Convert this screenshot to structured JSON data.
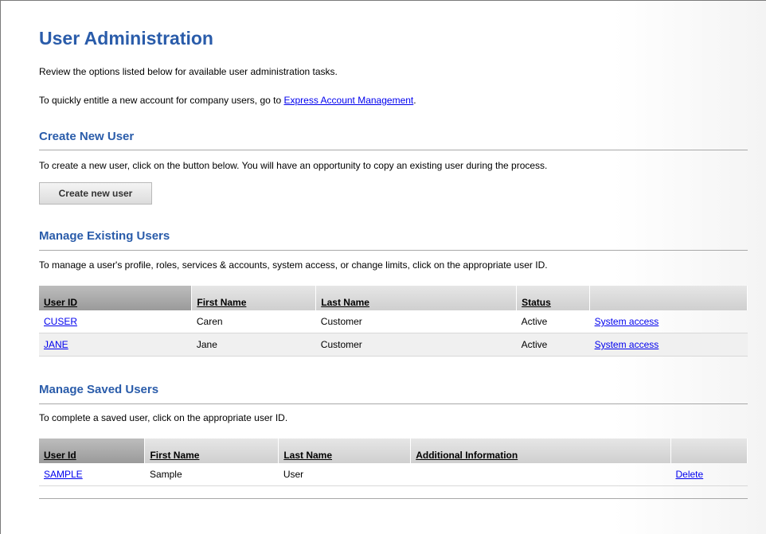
{
  "page": {
    "title": "User Administration",
    "intro": "Review the options listed below for available user administration tasks.",
    "express_prefix": "To quickly entitle a new account for company users, go to ",
    "express_link": "Express Account Management",
    "express_suffix": "."
  },
  "create": {
    "heading": "Create New User",
    "description": "To create a new user, click on the button below. You will have an opportunity to copy an existing user during the process.",
    "button_label": "Create new user"
  },
  "existing": {
    "heading": "Manage Existing Users",
    "description": "To manage a user's profile, roles, services & accounts, system access, or change limits, click on the appropriate user ID.",
    "columns": [
      "User ID",
      "First Name",
      "Last Name",
      "Status"
    ],
    "rows": [
      {
        "user_id": "CUSER",
        "first_name": "Caren",
        "last_name": "Customer",
        "status": "Active",
        "action": "System access"
      },
      {
        "user_id": "JANE",
        "first_name": "Jane",
        "last_name": "Customer",
        "status": "Active",
        "action": "System access"
      }
    ]
  },
  "saved": {
    "heading": "Manage Saved Users",
    "description": "To complete a saved user, click on the appropriate user ID.",
    "columns": [
      "User Id",
      "First Name",
      "Last Name",
      "Additional Information"
    ],
    "rows": [
      {
        "user_id": "SAMPLE",
        "first_name": "Sample",
        "last_name": "User",
        "info": "",
        "action": "Delete"
      }
    ]
  }
}
